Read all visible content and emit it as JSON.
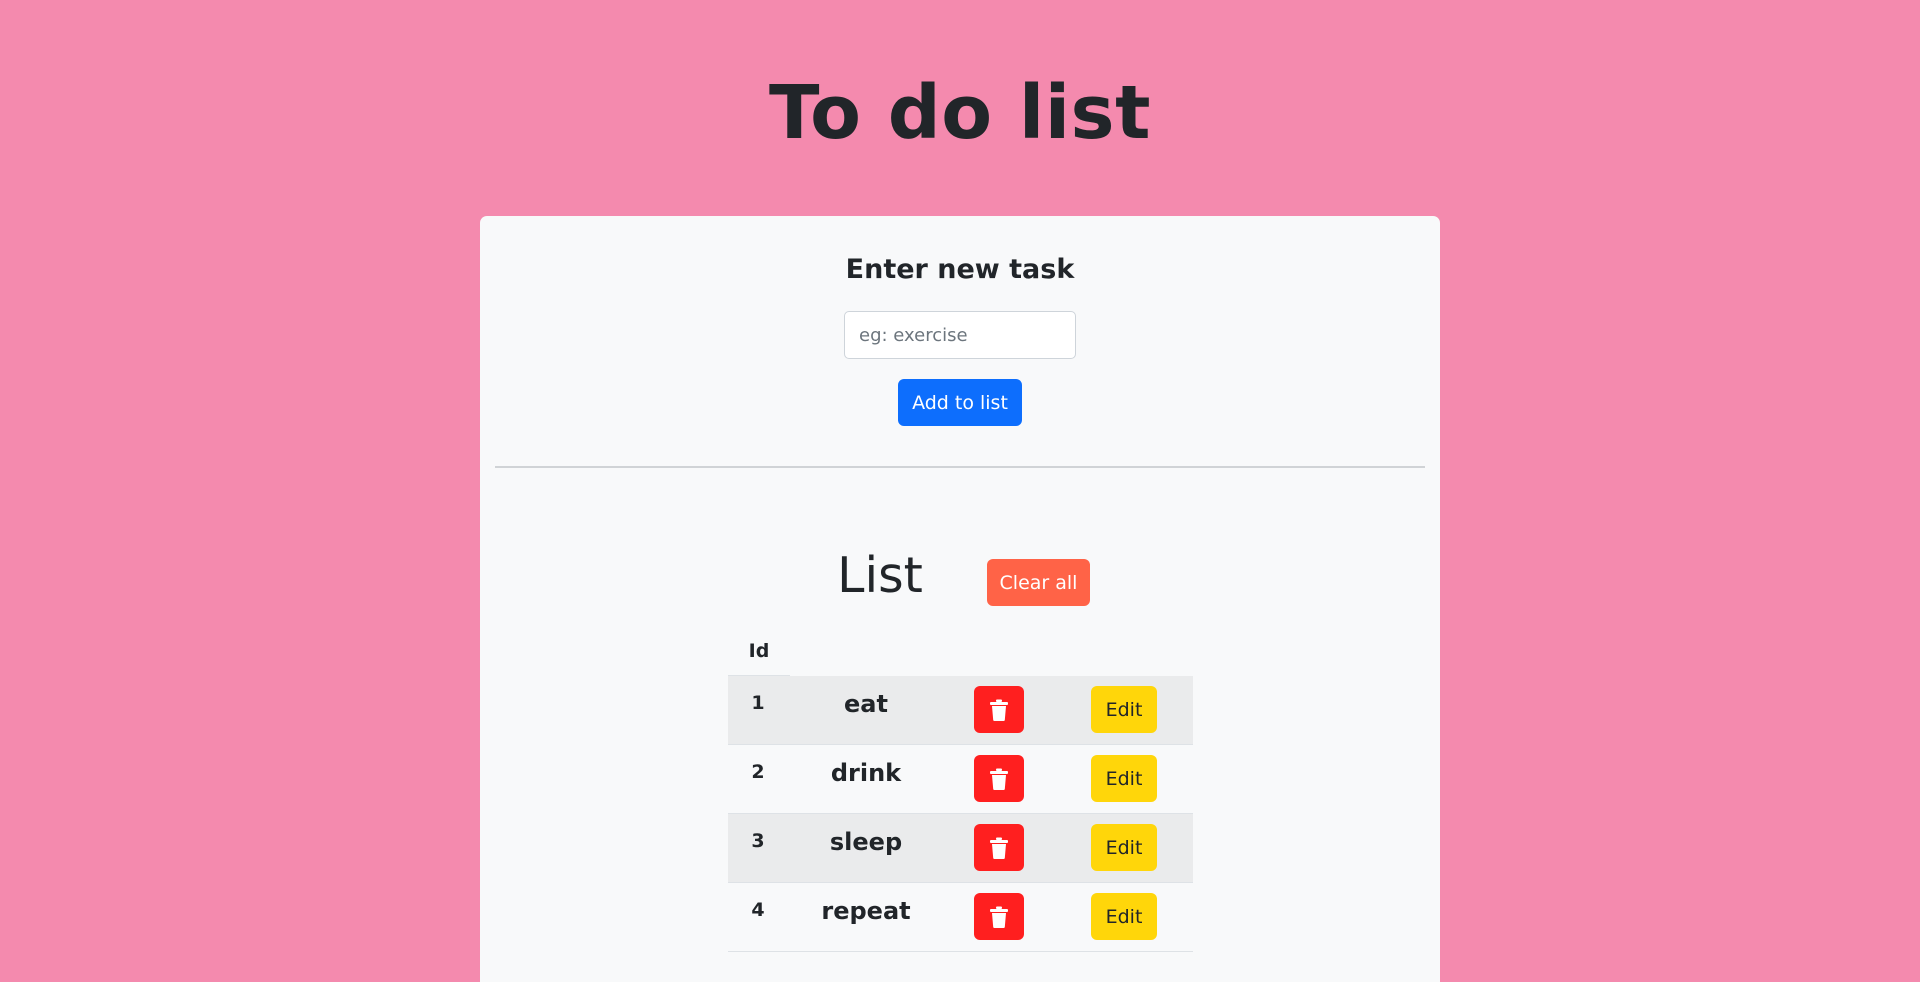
{
  "header": {
    "title": "To do list"
  },
  "form": {
    "heading": "Enter new task",
    "input_value": "",
    "input_placeholder": "eg: exercise",
    "add_label": "Add to list"
  },
  "list": {
    "heading": "List",
    "clear_label": "Clear all",
    "columns": {
      "id": "Id"
    },
    "delete_icon": "trash-icon",
    "edit_label": "Edit",
    "items": [
      {
        "id": "1",
        "name": "eat"
      },
      {
        "id": "2",
        "name": "drink"
      },
      {
        "id": "3",
        "name": "sleep"
      },
      {
        "id": "4",
        "name": "repeat"
      }
    ]
  },
  "colors": {
    "page_background": "#f48aae",
    "card_background": "#f8f9fa",
    "primary": "#0d6efd",
    "clear": "#ff6347",
    "delete": "#ff1f1f",
    "edit": "#ffd60a",
    "stripe": "#eaebec"
  }
}
